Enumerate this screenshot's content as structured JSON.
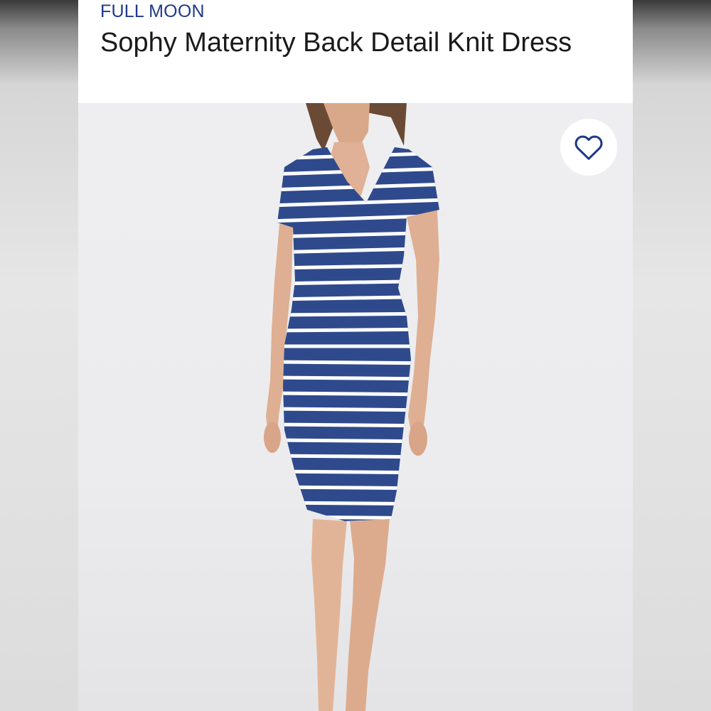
{
  "product": {
    "brand": "FULL MOON",
    "title": "Sophy Maternity Back Detail Knit Dress"
  },
  "image": {
    "subject": "model-wearing-striped-dress"
  },
  "favorite": {
    "icon": "heart-outline-icon",
    "color": "#1e3a8a"
  },
  "colors": {
    "dress_navy": "#2f4a8c",
    "stripe_white": "#ffffff",
    "brand_blue": "#1e3a8a"
  }
}
